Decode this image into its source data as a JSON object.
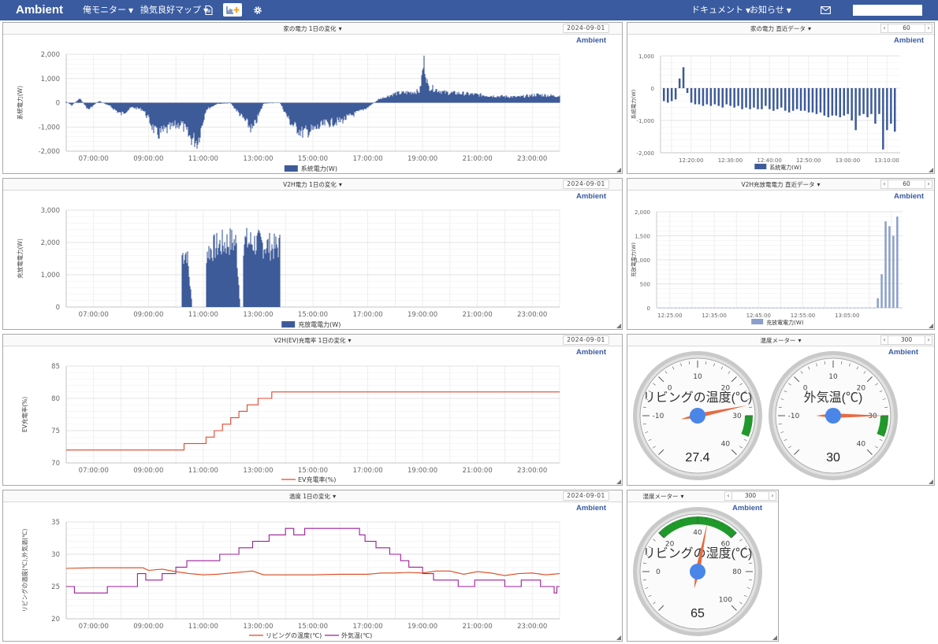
{
  "navbar": {
    "brand": "Ambient",
    "my_monitor": "俺モニター",
    "ventilation_map": "換気良好マップ",
    "docs": "ドキュメント",
    "news": "お知らせ",
    "search_value": "",
    "colors": {
      "bar": "#3a5ba0",
      "text": "#ffffff",
      "accent": "#f5a623"
    }
  },
  "colors": {
    "blue_series": "#3d5a99",
    "blue_light": "#8a9fcc",
    "ev_series": "#e0462f",
    "living_series": "#d94a1f",
    "outdoor_series": "#9b1f99",
    "gauge_green": "#1f9a2a",
    "needle": "#e66b43",
    "hub": "#4a86e8"
  },
  "panels": [
    {
      "title": "家の電力  1日の変化",
      "date": "2024-09-01",
      "logo": "Ambient",
      "chart_data": {
        "type": "area",
        "ylabel": "系統電力(W)",
        "xticks": [
          "07:00:00",
          "09:00:00",
          "11:00:00",
          "13:00:00",
          "15:00:00",
          "17:00:00",
          "19:00:00",
          "21:00:00",
          "23:00:00"
        ],
        "yticks": [
          "2,000",
          "1,000",
          "0",
          "-1,000",
          "-2,000"
        ],
        "ylim": [
          -2000,
          2000
        ],
        "xlim_hours": [
          6.0,
          24.0
        ],
        "series": [
          {
            "name": "系統電力(W)",
            "keyframes": [
              [
                6.0,
                50
              ],
              [
                6.2,
                -120
              ],
              [
                6.5,
                200
              ],
              [
                6.8,
                -300
              ],
              [
                7.2,
                80
              ],
              [
                7.6,
                -150
              ],
              [
                8.0,
                -500
              ],
              [
                8.4,
                -200
              ],
              [
                8.8,
                -300
              ],
              [
                9.0,
                -700
              ],
              [
                9.3,
                -1400
              ],
              [
                9.8,
                -1100
              ],
              [
                10.2,
                -900
              ],
              [
                10.5,
                -1500
              ],
              [
                10.8,
                -1700
              ],
              [
                11.1,
                -300
              ],
              [
                11.5,
                -50
              ],
              [
                12.0,
                -20
              ],
              [
                12.4,
                -600
              ],
              [
                12.8,
                -1200
              ],
              [
                13.2,
                -30
              ],
              [
                13.8,
                -10
              ],
              [
                14.2,
                -900
              ],
              [
                14.6,
                -1300
              ],
              [
                15.0,
                -1200
              ],
              [
                15.5,
                -900
              ],
              [
                16.0,
                -800
              ],
              [
                16.5,
                -500
              ],
              [
                17.0,
                -200
              ],
              [
                17.4,
                150
              ],
              [
                18.0,
                400
              ],
              [
                18.5,
                450
              ],
              [
                18.9,
                500
              ],
              [
                19.05,
                1800
              ],
              [
                19.2,
                700
              ],
              [
                19.8,
                450
              ],
              [
                20.5,
                400
              ],
              [
                21.0,
                350
              ],
              [
                21.5,
                300
              ],
              [
                22.5,
                250
              ],
              [
                23.2,
                350
              ],
              [
                23.8,
                300
              ],
              [
                24.0,
                300
              ]
            ]
          }
        ]
      }
    },
    {
      "title": "家の電力  直近データ",
      "count": "60",
      "logo": "Ambient",
      "chart_data": {
        "type": "bar",
        "ylabel": "系統電力(W)",
        "xticks": [
          "12:20:00",
          "12:30:00",
          "12:40:00",
          "12:50:00",
          "13:00:00",
          "13:10:00"
        ],
        "yticks": [
          "1,000",
          "0",
          "-1,000",
          "-2,000"
        ],
        "ylim": [
          -2000,
          1000
        ],
        "xlim_minutes": [
          12.2,
          73.4
        ],
        "values": [
          -400,
          -450,
          -400,
          -350,
          300,
          650,
          -150,
          -450,
          -500,
          -500,
          -550,
          -500,
          -550,
          -500,
          -550,
          -600,
          -500,
          -550,
          -600,
          -550,
          -650,
          -600,
          -650,
          -600,
          -650,
          -650,
          -550,
          -650,
          -700,
          -650,
          -600,
          -700,
          -750,
          -700,
          -650,
          -700,
          -700,
          -750,
          -750,
          -800,
          -750,
          -850,
          -900,
          -850,
          -850,
          -900,
          -850,
          -800,
          -1000,
          -1300,
          -850,
          -800,
          -900,
          -800,
          -1100,
          -800,
          -1900,
          -1300,
          -1100,
          -1350
        ]
      }
    },
    {
      "title": "V2H電力  1日の変化",
      "date": "2024-09-01",
      "logo": "Ambient",
      "chart_data": {
        "type": "area",
        "ylabel": "充放電電力(W)",
        "xticks": [
          "07:00:00",
          "09:00:00",
          "11:00:00",
          "13:00:00",
          "15:00:00",
          "17:00:00",
          "19:00:00",
          "21:00:00",
          "23:00:00"
        ],
        "yticks": [
          "3,000",
          "2,000",
          "1,000",
          "0"
        ],
        "ylim": [
          0,
          3000
        ],
        "xlim_hours": [
          6.0,
          24.0
        ],
        "series": [
          {
            "name": "充放電電力(W)",
            "keyframes": [
              [
                6.0,
                0
              ],
              [
                10.2,
                0
              ],
              [
                10.21,
                1700
              ],
              [
                10.4,
                1800
              ],
              [
                10.6,
                0
              ],
              [
                11.1,
                0
              ],
              [
                11.11,
                1800
              ],
              [
                11.5,
                2000
              ],
              [
                12.0,
                2150
              ],
              [
                12.2,
                2100
              ],
              [
                12.35,
                0
              ],
              [
                12.45,
                0
              ],
              [
                12.46,
                2150
              ],
              [
                12.8,
                2100
              ],
              [
                13.2,
                2050
              ],
              [
                13.6,
                1950
              ],
              [
                13.8,
                2000
              ],
              [
                13.81,
                0
              ],
              [
                24.0,
                0
              ]
            ]
          }
        ]
      }
    },
    {
      "title": "V2H充放電電力  直近データ",
      "count": "60",
      "logo": "Ambient",
      "chart_data": {
        "type": "bar",
        "ylabel": "充放電電力(W)",
        "xticks": [
          "12:25:00",
          "12:35:00",
          "12:45:00",
          "12:55:00",
          "13:05:00"
        ],
        "yticks": [
          "2,000",
          "1,500",
          "1,000",
          "500",
          "0"
        ],
        "ylim": [
          0,
          2000
        ],
        "xlim_minutes": [
          22.0,
          77.5
        ],
        "values": [
          0,
          0,
          0,
          0,
          0,
          0,
          0,
          0,
          0,
          0,
          0,
          0,
          0,
          0,
          0,
          0,
          0,
          0,
          0,
          0,
          0,
          0,
          0,
          0,
          0,
          0,
          0,
          0,
          0,
          0,
          0,
          0,
          0,
          0,
          0,
          0,
          0,
          0,
          0,
          0,
          0,
          0,
          0,
          0,
          0,
          0,
          0,
          0,
          0,
          0,
          0,
          0,
          0,
          0,
          0,
          0,
          200,
          700,
          1800,
          1700,
          1500,
          1900
        ]
      }
    },
    {
      "title": "V2H(EV)充電率  1日の変化",
      "date": "2024-09-01",
      "logo": "Ambient",
      "chart_data": {
        "type": "line",
        "ylabel": "EV充電率(%)",
        "xticks": [
          "07:00:00",
          "09:00:00",
          "11:00:00",
          "13:00:00",
          "15:00:00",
          "17:00:00",
          "19:00:00",
          "21:00:00",
          "23:00:00"
        ],
        "yticks": [
          "85",
          "80",
          "75",
          "70"
        ],
        "ylim": [
          70,
          85
        ],
        "xlim_hours": [
          6.0,
          24.0
        ],
        "series": [
          {
            "name": "EV充電率(%)",
            "steps": [
              [
                6.0,
                72
              ],
              [
                10.3,
                73
              ],
              [
                11.1,
                74
              ],
              [
                11.4,
                75
              ],
              [
                11.7,
                76
              ],
              [
                12.0,
                77
              ],
              [
                12.3,
                78
              ],
              [
                12.6,
                79
              ],
              [
                13.0,
                80
              ],
              [
                13.5,
                81
              ],
              [
                24.0,
                81
              ]
            ]
          }
        ]
      }
    },
    {
      "title": "温度メーター",
      "count": "300",
      "logo": "Ambient",
      "gauges": [
        {
          "label": "リビングの温度(℃)",
          "value": "27.4",
          "value_num": 27.4,
          "min": -20,
          "max": 40,
          "green_from": 30,
          "green_to": 35,
          "ticks": [
            "-10",
            "0",
            "10",
            "20",
            "30",
            "40"
          ]
        },
        {
          "label": "外気温(℃)",
          "value": "30",
          "value_num": 30,
          "min": -20,
          "max": 40,
          "green_from": 30,
          "green_to": 35,
          "ticks": [
            "-10",
            "0",
            "10",
            "20",
            "30",
            "40"
          ]
        }
      ]
    },
    {
      "title": "温度  1日の変化",
      "date": "2024-09-01",
      "logo": "Ambient",
      "chart_data": {
        "type": "line",
        "ylabel": "リビングの温度(℃),外気温(℃)",
        "xticks": [
          "07:00:00",
          "09:00:00",
          "11:00:00",
          "13:00:00",
          "15:00:00",
          "17:00:00",
          "19:00:00",
          "21:00:00",
          "23:00:00"
        ],
        "yticks": [
          "35",
          "30",
          "25",
          "20"
        ],
        "ylim": [
          20,
          35
        ],
        "xlim_hours": [
          6.0,
          24.0
        ],
        "series": [
          {
            "name": "リビングの温度(℃)",
            "points": [
              [
                6.0,
                27.8
              ],
              [
                7.0,
                27.9
              ],
              [
                8.0,
                27.9
              ],
              [
                8.8,
                27.9
              ],
              [
                9.0,
                27.5
              ],
              [
                9.5,
                27.7
              ],
              [
                10.0,
                27.3
              ],
              [
                10.5,
                27.0
              ],
              [
                11.0,
                26.8
              ],
              [
                11.5,
                26.9
              ],
              [
                12.0,
                27.1
              ],
              [
                12.8,
                27.4
              ],
              [
                13.2,
                26.8
              ],
              [
                14.0,
                26.8
              ],
              [
                15.0,
                26.8
              ],
              [
                16.0,
                26.9
              ],
              [
                17.0,
                26.9
              ],
              [
                17.5,
                27.1
              ],
              [
                18.0,
                27.1
              ],
              [
                18.5,
                27.2
              ],
              [
                19.0,
                27.1
              ],
              [
                19.5,
                27.4
              ],
              [
                20.0,
                27.4
              ],
              [
                20.5,
                26.9
              ],
              [
                21.0,
                27.3
              ],
              [
                21.5,
                27.1
              ],
              [
                22.0,
                26.7
              ],
              [
                22.5,
                27.0
              ],
              [
                23.0,
                27.1
              ],
              [
                23.5,
                26.8
              ],
              [
                24.0,
                27.0
              ]
            ]
          },
          {
            "name": "外気温(℃)",
            "steps": [
              [
                6.0,
                25
              ],
              [
                6.3,
                24
              ],
              [
                7.5,
                25
              ],
              [
                8.6,
                27
              ],
              [
                8.9,
                26
              ],
              [
                9.5,
                27
              ],
              [
                10.0,
                28
              ],
              [
                10.4,
                29
              ],
              [
                11.0,
                29
              ],
              [
                11.6,
                30
              ],
              [
                12.3,
                31
              ],
              [
                12.8,
                32
              ],
              [
                13.4,
                33
              ],
              [
                14.0,
                34
              ],
              [
                14.3,
                33
              ],
              [
                14.7,
                34
              ],
              [
                15.6,
                34
              ],
              [
                16.3,
                34
              ],
              [
                16.7,
                33
              ],
              [
                16.9,
                32
              ],
              [
                17.3,
                31
              ],
              [
                17.8,
                30
              ],
              [
                18.2,
                29
              ],
              [
                18.5,
                28
              ],
              [
                19.0,
                27
              ],
              [
                19.4,
                26
              ],
              [
                20.0,
                26
              ],
              [
                20.3,
                25
              ],
              [
                20.9,
                26
              ],
              [
                21.5,
                26
              ],
              [
                22.0,
                25
              ],
              [
                22.6,
                26
              ],
              [
                23.0,
                26
              ],
              [
                23.3,
                25
              ],
              [
                23.8,
                24
              ],
              [
                23.9,
                25
              ],
              [
                24.0,
                25
              ]
            ]
          }
        ]
      }
    },
    {
      "title": "湿度メーター",
      "count": "300",
      "logo": "Ambient",
      "gauges": [
        {
          "label": "リビングの湿度(℃)",
          "value": "65",
          "value_num": 65,
          "min": 0,
          "max": 120,
          "green_from": 40,
          "green_to": 80,
          "ticks": [
            "0",
            "20",
            "40",
            "60",
            "80",
            "100"
          ]
        }
      ]
    }
  ]
}
